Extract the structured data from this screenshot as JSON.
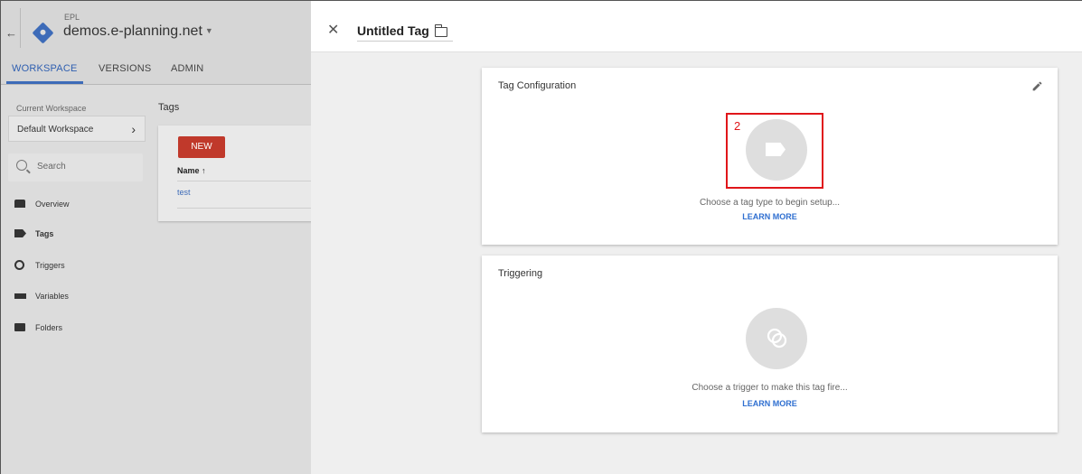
{
  "left": {
    "back_icon": "arrow-left-icon",
    "account": "EPL",
    "container": "demos.e-planning.net",
    "tabs": [
      "WORKSPACE",
      "VERSIONS",
      "ADMIN"
    ],
    "current_workspace_label": "Current Workspace",
    "workspace_name": "Default Workspace",
    "search_placeholder": "Search",
    "nav": [
      "Overview",
      "Tags",
      "Triggers",
      "Variables",
      "Folders"
    ],
    "tags_title": "Tags",
    "new_button": "NEW",
    "table_header": "Name ↑",
    "table_rows": [
      "test"
    ]
  },
  "panel": {
    "title": "Untitled Tag",
    "config": {
      "title": "Tag Configuration",
      "description": "Choose a tag type to begin setup...",
      "learn_more": "LEARN MORE",
      "highlight_number": "2"
    },
    "triggering": {
      "title": "Triggering",
      "description": "Choose a trigger to make this tag fire...",
      "learn_more": "LEARN MORE"
    }
  },
  "colors": {
    "accent_blue": "#2f6fd0",
    "new_button_red": "#c0392b",
    "highlight_red": "#e0161a"
  }
}
